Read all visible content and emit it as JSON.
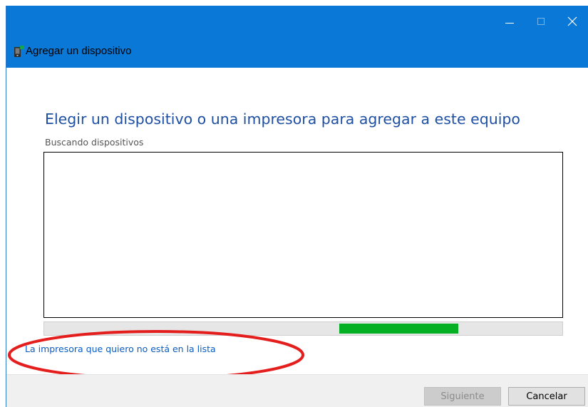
{
  "window": {
    "title": "Agregar un dispositivo",
    "title_icon": "devices-icon"
  },
  "caption_controls": {
    "minimize_icon": "minimize-icon",
    "maximize_icon": "maximize-icon",
    "close_icon": "close-icon"
  },
  "main": {
    "heading": "Elegir un dispositivo o una impresora para agregar a este equipo",
    "status": "Buscando dispositivos",
    "device_list": [],
    "progress": {
      "indeterminate": true,
      "fill_start_fraction": 0.57,
      "fill_end_fraction": 0.8,
      "color": "#06b025"
    },
    "printer_not_listed_link": "La impresora que quiero no está en la lista"
  },
  "footer": {
    "next_button": "Siguiente",
    "next_button_enabled": false,
    "cancel_button": "Cancelar"
  },
  "colors": {
    "titlebar": "#0a78d7",
    "heading": "#1f4fa3",
    "link": "#0b5cc2",
    "annotation": "#e41d1d"
  }
}
